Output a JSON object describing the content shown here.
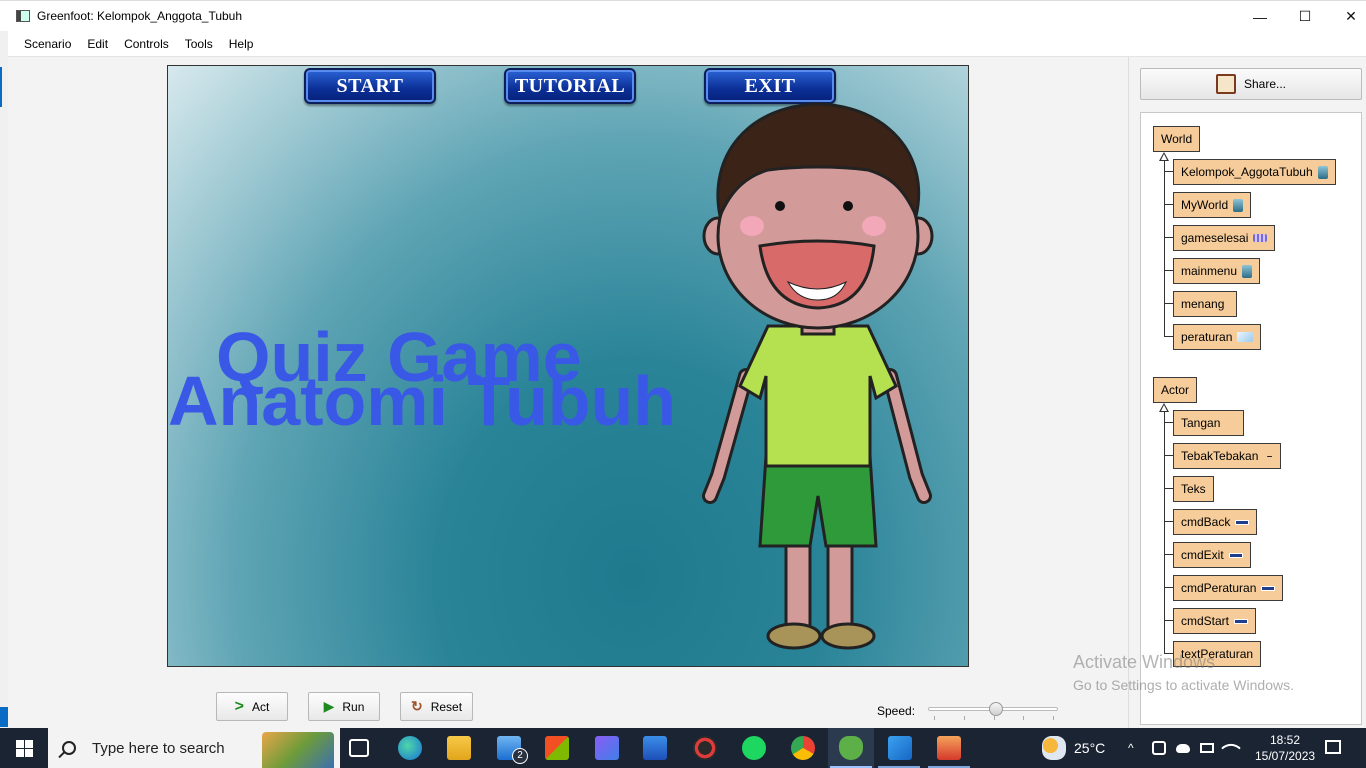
{
  "window": {
    "title": "Greenfoot: Kelompok_Anggota_Tubuh",
    "controls": [
      "—",
      "☐",
      "✕"
    ]
  },
  "menu": [
    "Scenario",
    "Edit",
    "Controls",
    "Tools",
    "Help"
  ],
  "world": {
    "buttons": [
      "START",
      "TUTORIAL",
      "EXIT"
    ],
    "title_line1": "Quiz Game",
    "title_line2": "Anatomi Tubuh"
  },
  "controls": {
    "act": "Act",
    "run": "Run",
    "reset": "Reset",
    "speed_label": "Speed:",
    "speed_value": 0.52
  },
  "share": {
    "label": "Share..."
  },
  "class_tree": {
    "world_root": "World",
    "world_subclasses": [
      "Kelompok_AggotaTubuh",
      "MyWorld",
      "gameselesai",
      "mainmenu",
      "menang",
      "peraturan"
    ],
    "actor_root": "Actor",
    "actor_subclasses": [
      "Tangan",
      "TebakTebakan",
      "Teks",
      "cmdBack",
      "cmdExit",
      "cmdPeraturan",
      "cmdStart",
      "textPeraturan"
    ]
  },
  "watermark": {
    "line1": "Activate Windows",
    "line2": "Go to Settings to activate Windows."
  },
  "taskbar": {
    "search_placeholder": "Type here to search",
    "mail_badge": "2",
    "weather": "25°C",
    "time": "18:52",
    "date": "15/07/2023"
  },
  "colors": {
    "class_box": "#f6cd9a",
    "title_text": "#3a58e6",
    "game_button": "#0b2f96",
    "taskbar": "#1b2433"
  }
}
